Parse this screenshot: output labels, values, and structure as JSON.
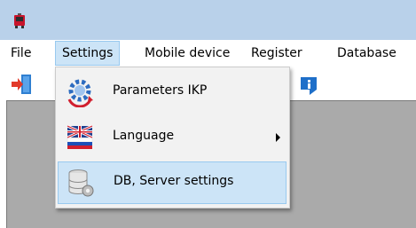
{
  "menubar": {
    "items": [
      "File",
      "Settings",
      "Mobile device",
      "Register",
      "Database"
    ]
  },
  "settings_menu": {
    "items": [
      {
        "label": "Parameters IKP",
        "icon": "gear-refresh-icon"
      },
      {
        "label": "Language",
        "icon": "flags-icon",
        "submenu": true
      },
      {
        "label": "DB, Server settings",
        "icon": "database-settings-icon"
      }
    ],
    "highlighted_item": "DB, Server settings"
  },
  "colors": {
    "titlebar": "#b9d1ea",
    "menu_highlight": "#cce4f7",
    "menu_highlight_border": "#99c9ef",
    "workspace": "#aaaaaa"
  }
}
